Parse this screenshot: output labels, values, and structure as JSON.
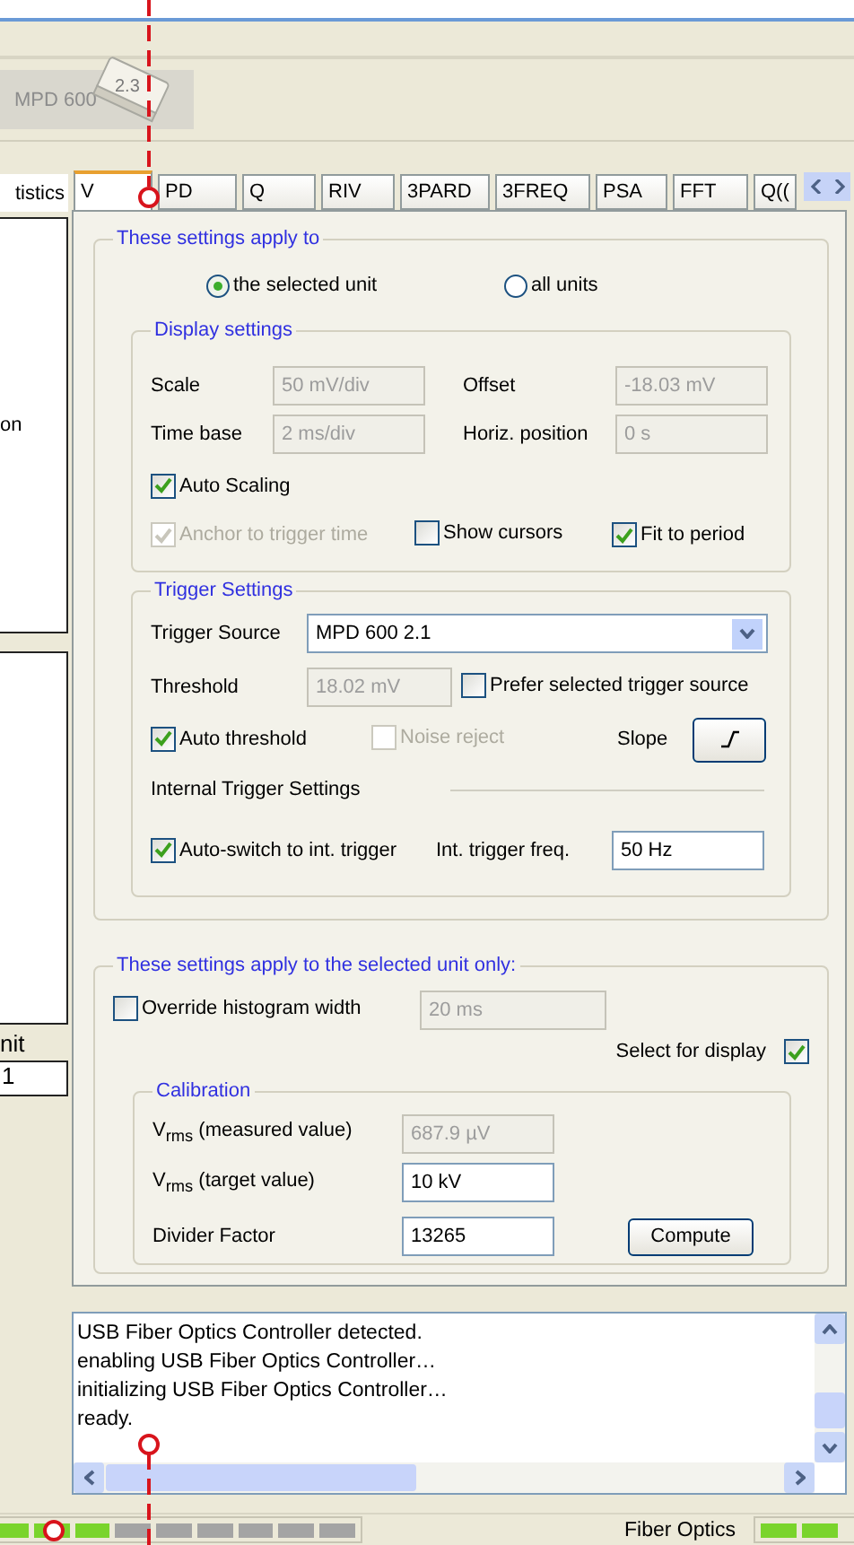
{
  "device": {
    "label": "MPD 600",
    "number": "2.3"
  },
  "left_panel": {
    "tab": "tistics",
    "text_1": "on",
    "text_2": "nit",
    "field": "1"
  },
  "tabs": [
    {
      "label": "V",
      "selected": true
    },
    {
      "label": "PD",
      "selected": false
    },
    {
      "label": "Q",
      "selected": false
    },
    {
      "label": "RIV",
      "selected": false
    },
    {
      "label": "3PARD",
      "selected": false
    },
    {
      "label": "3FREQ",
      "selected": false
    },
    {
      "label": "PSA",
      "selected": false
    },
    {
      "label": "FFT",
      "selected": false
    },
    {
      "label": "Q((",
      "selected": false
    }
  ],
  "apply_to": {
    "title": "These settings apply to",
    "options": [
      {
        "label": "the selected unit",
        "selected": true
      },
      {
        "label": "all units",
        "selected": false
      }
    ]
  },
  "display": {
    "title": "Display settings",
    "fields": [
      {
        "label": "Scale",
        "value": "50 mV/div",
        "disabled": true
      },
      {
        "label": "Offset",
        "value": "-18.03 mV",
        "disabled": true
      },
      {
        "label": "Time base",
        "value": "2 ms/div",
        "disabled": true
      },
      {
        "label": "Horiz. position",
        "value": "0 s",
        "disabled": true
      }
    ],
    "auto_scaling": {
      "label": "Auto Scaling",
      "checked": true,
      "disabled": false
    },
    "options": [
      {
        "label": "Anchor to trigger time",
        "checked": true,
        "disabled": true
      },
      {
        "label": "Show cursors",
        "checked": false,
        "disabled": false
      },
      {
        "label": "Fit to period",
        "checked": true,
        "disabled": false
      }
    ]
  },
  "trigger": {
    "title": "Trigger Settings",
    "source_label": "Trigger Source",
    "source_value": "MPD 600 2.1",
    "threshold_label": "Threshold",
    "threshold": {
      "value": "18.02 mV",
      "disabled": true
    },
    "prefer": {
      "label": "Prefer selected trigger source",
      "checked": false,
      "disabled": false
    },
    "auto_threshold": {
      "label": "Auto threshold",
      "checked": true,
      "disabled": false
    },
    "noise_reject": {
      "label": "Noise reject",
      "checked": false,
      "disabled": true
    },
    "slope_label": "Slope",
    "internal_title": "Internal Trigger Settings",
    "auto_switch": {
      "label": "Auto-switch to int. trigger",
      "checked": true,
      "disabled": false
    },
    "freq_label": "Int. trigger freq.",
    "freq": {
      "value": "50 Hz",
      "disabled": false
    }
  },
  "unit_only": {
    "title": "These settings apply to the selected unit only:",
    "override": {
      "label": "Override histogram width",
      "checked": false,
      "disabled": false
    },
    "histogram": {
      "value": "20 ms",
      "disabled": true
    },
    "select_display": {
      "label": "Select for display",
      "checked": true,
      "disabled": false
    },
    "calibration": {
      "title": "Calibration",
      "rows": [
        {
          "label": "V$_{rms}$ (measured value)",
          "value": "687.9 µV",
          "disabled": true
        },
        {
          "label": "V$_{rms}$ (target value)",
          "value": "10 kV",
          "disabled": false
        },
        {
          "label": "Divider Factor",
          "value": "13265",
          "disabled": false
        }
      ],
      "compute": "Compute"
    }
  },
  "log": [
    "USB Fiber Optics Controller detected.",
    "enabling USB Fiber Optics Controller…",
    "initializing USB Fiber Optics Controller…",
    "ready."
  ],
  "status": {
    "left_leds": [
      {
        "on": true
      },
      {
        "on": true
      },
      {
        "on": true
      },
      {
        "on": false
      },
      {
        "on": false
      },
      {
        "on": false
      },
      {
        "on": false
      },
      {
        "on": false
      },
      {
        "on": false
      }
    ],
    "label": "Fiber Optics",
    "right_leds": [
      {
        "on": true
      },
      {
        "on": true
      }
    ]
  }
}
